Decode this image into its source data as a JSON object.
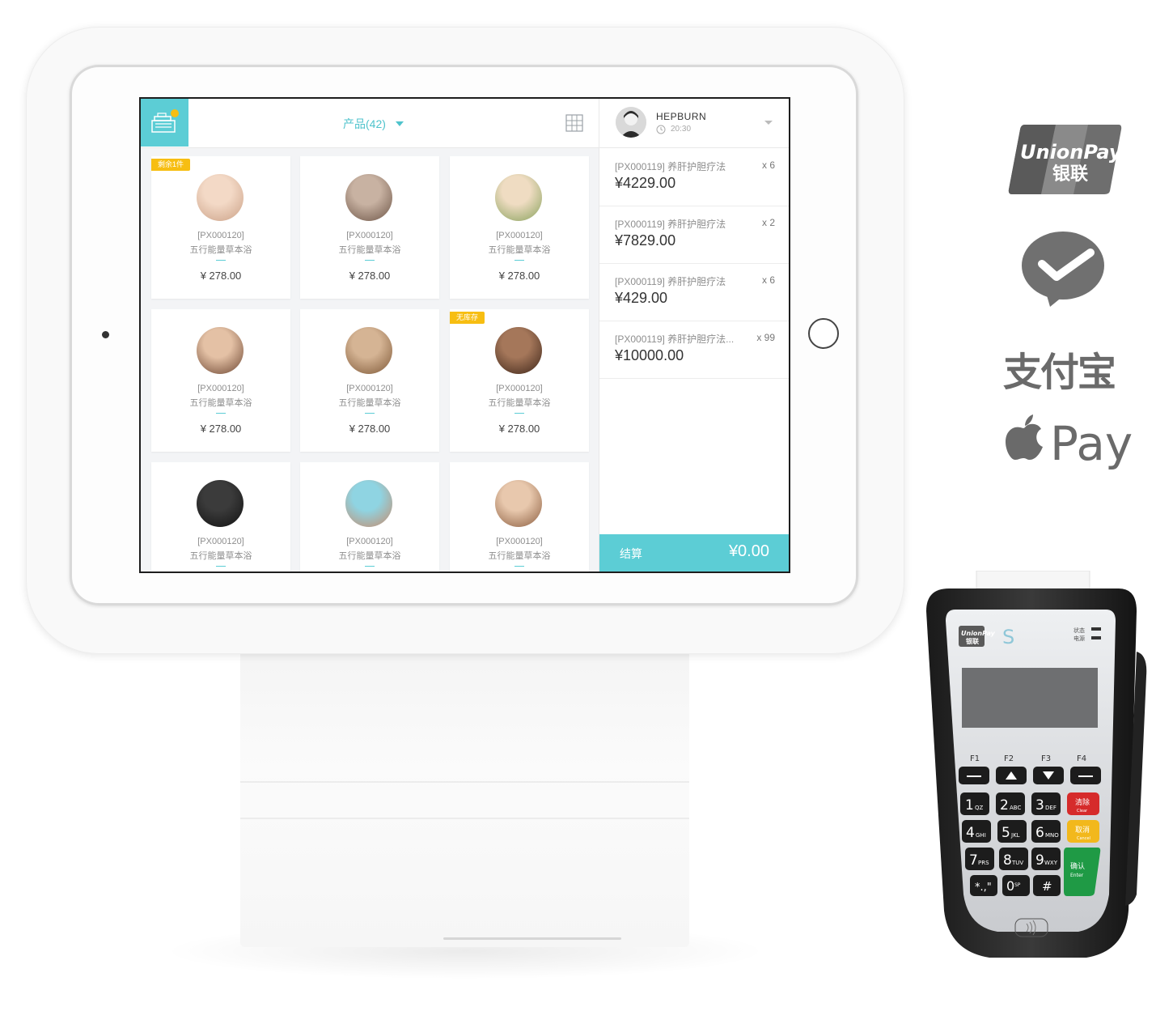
{
  "app": {
    "product_title": "产品(42)",
    "customer": {
      "name": "HEPBURN",
      "time": "20:30"
    },
    "products": [
      {
        "code": "[PX000120]",
        "name": "五行能量草本浴",
        "price": "¥ 278.00",
        "badge": "剩余1件",
        "colors": [
          "#f3d9c6",
          "#caa086"
        ]
      },
      {
        "code": "[PX000120]",
        "name": "五行能量草本浴",
        "price": "¥ 278.00",
        "badge": "",
        "colors": [
          "#c8b2a2",
          "#6c5446"
        ]
      },
      {
        "code": "[PX000120]",
        "name": "五行能量草本浴",
        "price": "¥ 278.00",
        "badge": "",
        "colors": [
          "#efdcc2",
          "#86a05a"
        ]
      },
      {
        "code": "[PX000120]",
        "name": "五行能量草本浴",
        "price": "¥ 278.00",
        "badge": "",
        "colors": [
          "#e4c1a5",
          "#6b4430"
        ]
      },
      {
        "code": "[PX000120]",
        "name": "五行能量草本浴",
        "price": "¥ 278.00",
        "badge": "",
        "colors": [
          "#d5b494",
          "#7d5736"
        ]
      },
      {
        "code": "[PX000120]",
        "name": "五行能量草本浴",
        "price": "¥ 278.00",
        "badge": "无库存",
        "colors": [
          "#a5775a",
          "#3c2418"
        ]
      },
      {
        "code": "[PX000120]",
        "name": "五行能量草本浴",
        "price": "",
        "badge": "",
        "colors": [
          "#3b3b3b",
          "#111111"
        ]
      },
      {
        "code": "[PX000120]",
        "name": "五行能量草本浴",
        "price": "",
        "badge": "",
        "colors": [
          "#8fd4e2",
          "#c98a6a"
        ]
      },
      {
        "code": "[PX000120]",
        "name": "五行能量草本浴",
        "price": "",
        "badge": "",
        "colors": [
          "#e8c8ad",
          "#8a5c3e"
        ]
      }
    ],
    "order_items": [
      {
        "name": "[PX000119] 养肝护胆疗法",
        "qty": "x 6",
        "price": "¥4229.00"
      },
      {
        "name": "[PX000119] 养肝护胆疗法",
        "qty": "x 2",
        "price": "¥7829.00"
      },
      {
        "name": "[PX000119] 养肝护胆疗法",
        "qty": "x 6",
        "price": "¥429.00"
      },
      {
        "name": "[PX000119] 养肝护胆疗法...",
        "qty": "x 99",
        "price": "¥10000.00"
      }
    ],
    "checkout": {
      "label": "结算",
      "total": "¥0.00"
    },
    "accent_color": "#5ccdd5",
    "badge_color": "#f7be12"
  },
  "payment_logos": {
    "unionpay": {
      "line1": "UnionPay",
      "line2": "银联"
    },
    "wechat": "wechat-pay-icon",
    "alipay": "支付宝",
    "applepay": "Pay"
  },
  "terminal": {
    "brand": "UnionPay",
    "brand_cn": "银联",
    "status_labels": [
      "状态",
      "电源"
    ],
    "fn_labels": [
      "F1",
      "F2",
      "F3",
      "F4"
    ],
    "keys": [
      {
        "main": "1",
        "sub": "QZ"
      },
      {
        "main": "2",
        "sub": "ABC"
      },
      {
        "main": "3",
        "sub": "DEF"
      },
      {
        "main": "4",
        "sub": "GHI"
      },
      {
        "main": "5",
        "sub": "JKL"
      },
      {
        "main": "6",
        "sub": "MNO"
      },
      {
        "main": "7",
        "sub": "PRS"
      },
      {
        "main": "8",
        "sub": "TUV"
      },
      {
        "main": "9",
        "sub": "WXY"
      },
      {
        "main": "*.,\"",
        "sub": ""
      },
      {
        "main": "0",
        "sub": "SP"
      },
      {
        "main": "#",
        "sub": ""
      }
    ],
    "clear": {
      "cn": "清除",
      "en": "Clear"
    },
    "cancel": {
      "cn": "取消",
      "en": "Cancel"
    },
    "enter": {
      "cn": "确认",
      "en": "Enter"
    }
  }
}
